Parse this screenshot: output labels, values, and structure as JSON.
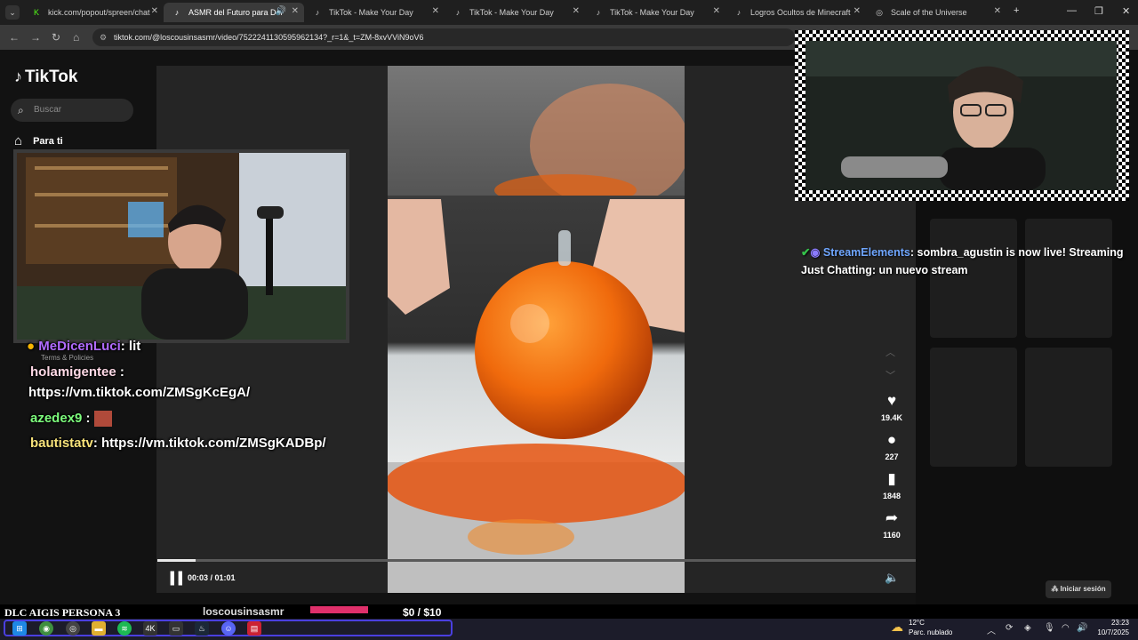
{
  "browser": {
    "tabs": [
      {
        "title": "kick.com/popout/spreen/chat",
        "favicon": "kick-icon"
      },
      {
        "title": "ASMR del Futuro para Dor",
        "favicon": "tiktok-icon",
        "audio": true
      },
      {
        "title": "TikTok - Make Your Day",
        "favicon": "tiktok-icon"
      },
      {
        "title": "TikTok - Make Your Day",
        "favicon": "tiktok-icon"
      },
      {
        "title": "TikTok - Make Your Day",
        "favicon": "tiktok-icon"
      },
      {
        "title": "Logros Ocultos de Minecraft",
        "favicon": "tiktok-icon"
      },
      {
        "title": "Scale of the Universe",
        "favicon": "globe-icon"
      }
    ],
    "url": "tiktok.com/@loscousinsasmr/video/7522241130595962134?_r=1&_t=ZM-8xvVViN9oV6"
  },
  "tiktok": {
    "logo": "TikTok",
    "search_placeholder": "Buscar",
    "nav_for_you": "Para ti",
    "terms": "Terms & Policies",
    "time": "00:03 / 01:01",
    "progress": 0.05,
    "actions": {
      "likes": "19.4K",
      "comments": "227",
      "saves": "1848",
      "shares": "1160"
    },
    "login": "Iniciar sesión",
    "uploader": "loscousinsasmr"
  },
  "chat": [
    {
      "user": "MeDicenLuci",
      "color": "#b06bff",
      "text": ": lit"
    },
    {
      "user": "holamigentee",
      "color": "#ffd9e6",
      "text": " :"
    },
    {
      "user": "",
      "color": "#ffffff",
      "text": "https://vm.tiktok.com/ZMSgKcEgA/"
    },
    {
      "user": "azedex9",
      "color": "#7CFC7C",
      "text": " :"
    },
    {
      "user": "bautistatv",
      "color": "#f7e27a",
      "text": ": https://vm.tiktok.com/ZMSgKADBp/"
    }
  ],
  "stream_elements": {
    "name": "StreamElements",
    "message": ": sombra_agustin is now live! Streaming Just Chatting: un nuevo stream"
  },
  "stream_bar": {
    "game": "DLC AIGIS PERSONA 3",
    "goal": "$0   / $10"
  },
  "taskbar": {
    "temp": "12°C",
    "weather": "Parc. nublado",
    "time": "23:23",
    "date": "10/7/2025"
  }
}
